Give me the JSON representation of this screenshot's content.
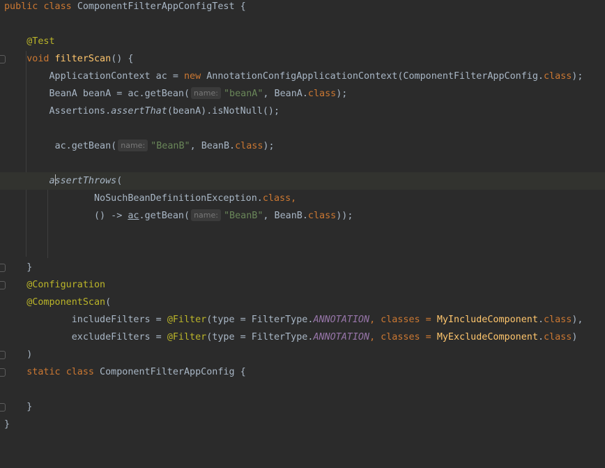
{
  "code": {
    "l1_kw1": "public",
    "l1_kw2": "class",
    "l1_name": "ComponentFilterAppConfigTest",
    "l1_brace": "{",
    "l3_ann": "@Test",
    "l4_kw": "void",
    "l4_fn": "filterScan",
    "l4_rest": "() {",
    "l5_a": "ApplicationContext ac = ",
    "l5_new": "new",
    "l5_b": " AnnotationConfigApplicationContext(ComponentFilterAppConfig.",
    "l5_cls": "class",
    "l5_c": ");",
    "l6_a": "BeanA beanA = ac.getBean(",
    "l6_hint": "name:",
    "l6_str": "\"beanA\"",
    "l6_b": ", BeanA.",
    "l6_cls": "class",
    "l6_c": ");",
    "l7_a": "Assertions.",
    "l7_it": "assertThat",
    "l7_b": "(beanA).isNotNull();",
    "l9_a": "ac.getBean(",
    "l9_hint": "name:",
    "l9_str": "\"BeanB\"",
    "l9_b": ", BeanB.",
    "l9_cls": "class",
    "l9_c": ");",
    "l11_a": "a",
    "l11_it": "ssertThrows",
    "l11_b": "(",
    "l12_a": "NoSuchBeanDefinitionException.",
    "l12_cls": "class",
    "l12_b": ",",
    "l13_a": "() -> ",
    "l13_ul": "ac",
    "l13_b": ".getBean(",
    "l13_hint": "name:",
    "l13_str": "\"BeanB\"",
    "l13_c": ", BeanB.",
    "l13_cls": "class",
    "l13_d": "));",
    "l16_brace": "}",
    "l17_ann": "@Configuration",
    "l18_ann": "@ComponentScan",
    "l18_b": "(",
    "l19_a": "includeFilters = ",
    "l19_ann": "@Filter",
    "l19_b": "(type = FilterType.",
    "l19_const": "ANNOTATION",
    "l19_c": ", classes = ",
    "l19_ref": "MyIncludeComponent",
    "l19_d": ".",
    "l19_cls": "class",
    "l19_e": "),",
    "l20_a": "excludeFilters = ",
    "l20_ann": "@Filter",
    "l20_b": "(type = FilterType.",
    "l20_const": "ANNOTATION",
    "l20_c": ", classes = ",
    "l20_ref": "MyExcludeComponent",
    "l20_d": ".",
    "l20_cls": "class",
    "l20_e": ")",
    "l21_paren": ")",
    "l22_kw1": "static",
    "l22_kw2": "class",
    "l22_rest": " ComponentFilterAppConfig {",
    "l24_brace": "}",
    "l25_brace": "}"
  },
  "colors": {
    "background": "#2b2b2b",
    "current_line": "#32332f",
    "keyword": "#cc7832",
    "annotation": "#bbb529",
    "method": "#ffc66d",
    "string": "#6a8759",
    "constant": "#9876aa",
    "text": "#a9b7c6",
    "hint_text": "#787878"
  }
}
